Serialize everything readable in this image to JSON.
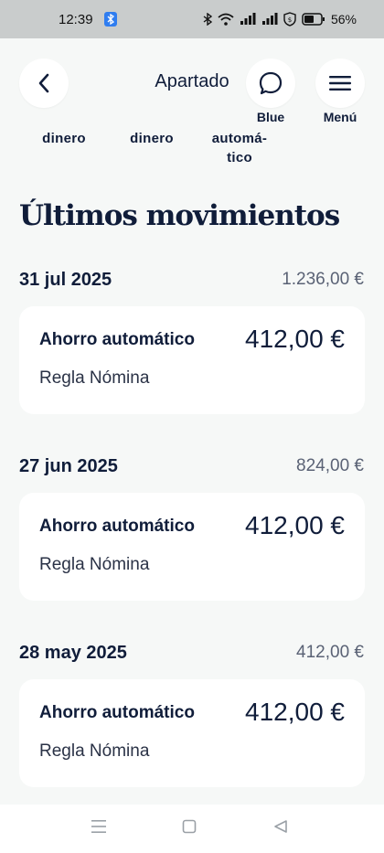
{
  "status_bar": {
    "time": "12:39",
    "battery": "56%",
    "icons": [
      "bluetooth-app-icon",
      "bluetooth-icon",
      "wifi-icon",
      "signal-icon",
      "signal-icon",
      "vpn-shield-icon",
      "battery-icon"
    ]
  },
  "header": {
    "title": "Apartado",
    "blue_label": "Blue",
    "menu_label": "Menú"
  },
  "truncated_actions": [
    {
      "label": "dinero"
    },
    {
      "label": "dinero"
    },
    {
      "label": "automá-\ntico"
    }
  ],
  "section_title": "Últimos movimientos",
  "groups": [
    {
      "date": "31 jul 2025",
      "total": "1.236,00 €",
      "movement": {
        "title": "Ahorro automático",
        "amount": "412,00 €",
        "subtitle": "Regla Nómina"
      }
    },
    {
      "date": "27 jun 2025",
      "total": "824,00 €",
      "movement": {
        "title": "Ahorro automático",
        "amount": "412,00 €",
        "subtitle": "Regla Nómina"
      }
    },
    {
      "date": "28 may 2025",
      "total": "412,00 €",
      "movement": {
        "title": "Ahorro automático",
        "amount": "412,00 €",
        "subtitle": "Regla Nómina"
      }
    }
  ],
  "colors": {
    "navy": "#101d3a",
    "background": "#f6f8f7",
    "card": "#ffffff",
    "status_bar": "#c9cccc",
    "muted": "#5a6275"
  }
}
